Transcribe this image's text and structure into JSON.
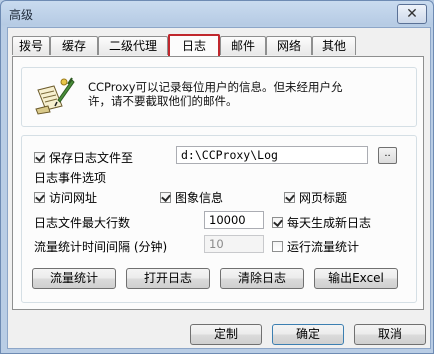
{
  "window": {
    "title": "高级",
    "close_symbol": "✕"
  },
  "tabs": [
    {
      "label": "拨号",
      "active": false
    },
    {
      "label": "缓存",
      "active": false
    },
    {
      "label": "二级代理",
      "active": false
    },
    {
      "label": "日志",
      "active": true
    },
    {
      "label": "邮件",
      "active": false
    },
    {
      "label": "网络",
      "active": false
    },
    {
      "label": "其他",
      "active": false
    }
  ],
  "info": {
    "icon": "scroll-quill-icon",
    "text_line1": "CCProxy可以记录每位用户的信息。但未经用户允",
    "text_line2": "许，请不要截取他们的邮件。"
  },
  "log": {
    "save_label": "保存日志文件至",
    "save_checked": true,
    "path_value": "d:\\CCProxy\\Log",
    "browse_label": "..",
    "event_options_label": "日志事件选项",
    "visit_url_label": "访问网址",
    "visit_url_checked": true,
    "image_info_label": "图象信息",
    "image_info_checked": true,
    "page_title_label": "网页标题",
    "page_title_checked": true,
    "max_lines_label": "日志文件最大行数",
    "max_lines_value": "10000",
    "daily_new_label": "每天生成新日志",
    "daily_new_checked": true,
    "interval_label": "流量统计时间间隔 (分钟)",
    "interval_value": "10",
    "run_stats_label": "运行流量统计",
    "run_stats_checked": false
  },
  "actions": {
    "traffic_stats": "流量统计",
    "open_log": "打开日志",
    "clear_log": "清除日志",
    "export_excel": "输出Excel"
  },
  "footer": {
    "customize": "定制",
    "ok": "确定",
    "cancel": "取消"
  }
}
